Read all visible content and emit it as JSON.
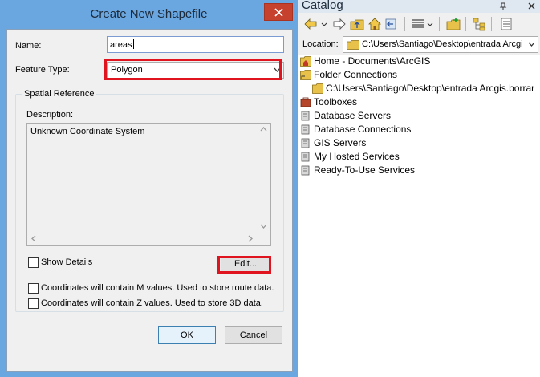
{
  "dialog": {
    "title": "Create New Shapefile",
    "name_label": "Name:",
    "name_value": "areas",
    "feature_type_label": "Feature Type:",
    "feature_type_value": "Polygon",
    "spatial_reference_label": "Spatial Reference",
    "description_label": "Description:",
    "description_text": "Unknown Coordinate System",
    "show_details_label": "Show Details",
    "edit_button": "Edit...",
    "m_values_label": "Coordinates will contain M values. Used to store route data.",
    "z_values_label": "Coordinates will contain Z values. Used to store 3D data.",
    "ok_button": "OK",
    "cancel_button": "Cancel"
  },
  "catalog": {
    "title": "Catalog",
    "location_label": "Location:",
    "location_value": "C:\\Users\\Santiago\\Desktop\\entrada Arcgi",
    "tree": [
      {
        "label": "Home - Documents\\ArcGIS",
        "icon": "home-folder-icon"
      },
      {
        "label": "Folder Connections",
        "icon": "folder-connections-icon"
      },
      {
        "label": "C:\\Users\\Santiago\\Desktop\\entrada Arcgis.borrar",
        "icon": "folder-icon"
      },
      {
        "label": "Toolboxes",
        "icon": "toolbox-icon"
      },
      {
        "label": "Database Servers",
        "icon": "database-server-icon"
      },
      {
        "label": "Database Connections",
        "icon": "database-connection-icon"
      },
      {
        "label": "GIS Servers",
        "icon": "gis-server-icon"
      },
      {
        "label": "My Hosted Services",
        "icon": "hosted-services-icon"
      },
      {
        "label": "Ready-To-Use Services",
        "icon": "ready-services-icon"
      }
    ]
  },
  "colors": {
    "title_bar": "#6aa6e0",
    "close_button": "#c7412f",
    "highlight": "#e0141e",
    "folder": "#e8c14a"
  }
}
